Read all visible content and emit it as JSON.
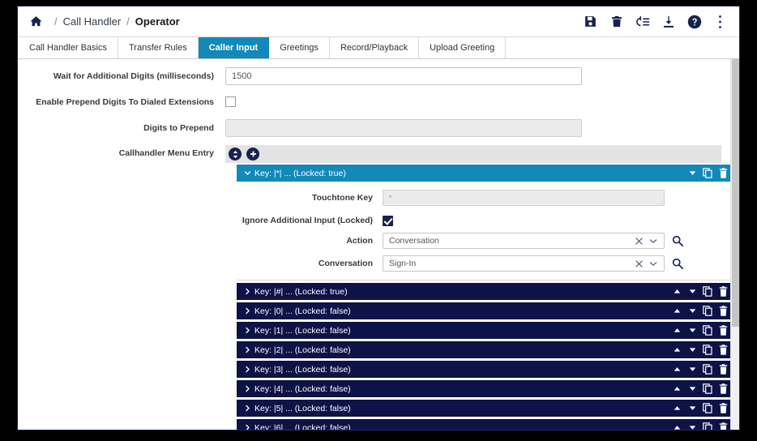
{
  "header": {
    "home_icon": "home-icon",
    "breadcrumb": {
      "separator": "/",
      "parent": "Call Handler",
      "current": "Operator"
    },
    "tools": [
      {
        "name": "save-icon",
        "label": "Save"
      },
      {
        "name": "delete-icon",
        "label": "Delete"
      },
      {
        "name": "refresh-list-icon",
        "label": "Refresh"
      },
      {
        "name": "download-icon",
        "label": "Download"
      },
      {
        "name": "help-icon",
        "label": "Help"
      },
      {
        "name": "more-options-icon",
        "label": "More"
      }
    ]
  },
  "tabs": [
    {
      "label": "Call Handler Basics",
      "active": false
    },
    {
      "label": "Transfer Rules",
      "active": false
    },
    {
      "label": "Caller Input",
      "active": true
    },
    {
      "label": "Greetings",
      "active": false
    },
    {
      "label": "Record/Playback",
      "active": false
    },
    {
      "label": "Upload Greeting",
      "active": false
    }
  ],
  "form": {
    "wait_digits": {
      "label": "Wait for Additional Digits (milliseconds)",
      "value": "1500"
    },
    "enable_prepend": {
      "label": "Enable Prepend Digits To Dialed Extensions",
      "checked": false
    },
    "digits_to_prepend": {
      "label": "Digits to Prepend",
      "value": "",
      "placeholder": "",
      "disabled": true
    },
    "menu_entry": {
      "label": "Callhandler Menu Entry",
      "toolbar": [
        {
          "name": "expand-collapse-all-button",
          "glyph": "updown"
        },
        {
          "name": "add-menu-entry-button",
          "glyph": "plus"
        }
      ]
    }
  },
  "accordion": {
    "expanded_entry": {
      "title": "Key: |*| ... (Locked: true)",
      "fields": {
        "touchtone_key": {
          "label": "Touchtone Key",
          "value": "*",
          "disabled": true
        },
        "ignore_additional_input": {
          "label": "Ignore Additional Input (Locked)",
          "checked": true
        },
        "action": {
          "label": "Action",
          "value": "Conversation"
        },
        "conversation": {
          "label": "Conversation",
          "value": "Sign-In"
        }
      },
      "actions": [
        "move-down-icon",
        "copy-icon",
        "delete-icon"
      ]
    },
    "collapsed_entries": [
      {
        "title": "Key: |#| ... (Locked: true)"
      },
      {
        "title": "Key: |0| ... (Locked: false)"
      },
      {
        "title": "Key: |1| ... (Locked: false)"
      },
      {
        "title": "Key: |2| ... (Locked: false)"
      },
      {
        "title": "Key: |3| ... (Locked: false)"
      },
      {
        "title": "Key: |4| ... (Locked: false)"
      },
      {
        "title": "Key: |5| ... (Locked: false)"
      },
      {
        "title": "Key: |6| ... (Locked: false)"
      }
    ],
    "row_actions": [
      "move-up-icon",
      "move-down-icon",
      "copy-icon",
      "delete-icon"
    ]
  },
  "colors": {
    "accent_blue": "#1289b9",
    "navy": "#0d1347",
    "dark_navy_icon": "#17224e",
    "toolbar_gray": "#e3e3e3"
  }
}
